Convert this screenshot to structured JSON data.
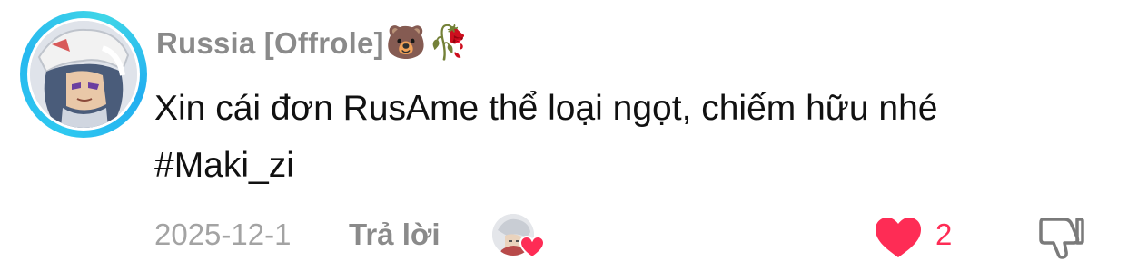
{
  "comment": {
    "username": "Russia [Offrole]",
    "username_emojis": [
      "🐻",
      "🥀"
    ],
    "text": "Xin cái đơn RusAme thể loại ngọt, chiếm hữu nhé\n#Maki_zi",
    "date": "2025-12-1",
    "reply_label": "Trả lời",
    "like_count": "2",
    "icons": {
      "like": "heart-icon",
      "dislike": "thumbs-down-icon",
      "creator_like_badge": "heart-badge-icon"
    }
  },
  "colors": {
    "avatar_ring": "#2ec9f0",
    "username": "#8a8a8a",
    "text": "#111111",
    "meta": "#a3a3a3",
    "like": "#fe2c55"
  }
}
